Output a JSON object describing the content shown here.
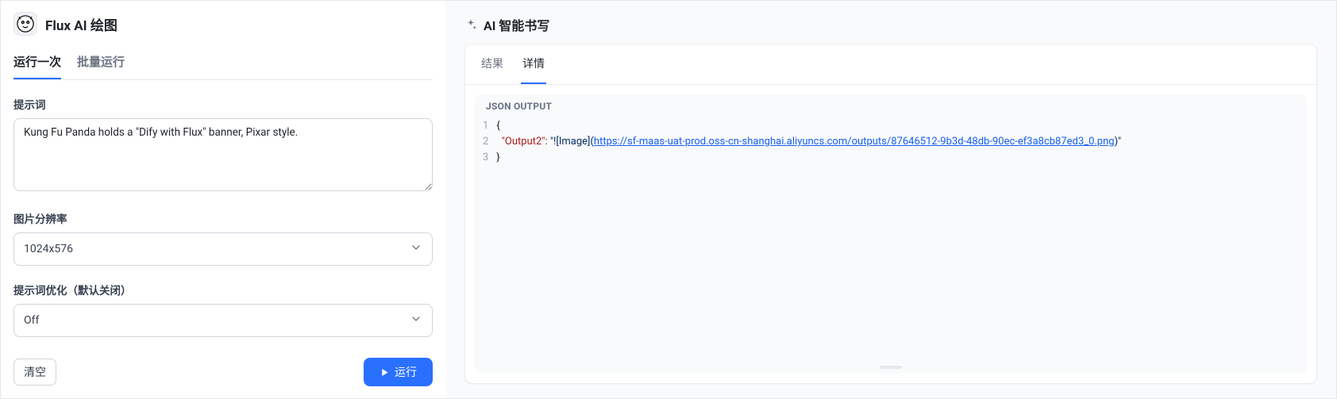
{
  "left": {
    "title": "Flux AI 绘图",
    "tabs": [
      {
        "label": "运行一次",
        "active": true
      },
      {
        "label": "批量运行",
        "active": false
      }
    ],
    "promptLabel": "提示词",
    "promptValue": "Kung Fu Panda holds a \"Dify with Flux\" banner, Pixar style.",
    "resolutionLabel": "图片分辨率",
    "resolutionValue": "1024x576",
    "optimizeLabel": "提示词优化（默认关闭）",
    "optimizeValue": "Off",
    "clearLabel": "清空",
    "runLabel": "运行"
  },
  "right": {
    "title": "AI 智能书写",
    "tabs": [
      {
        "label": "结果",
        "active": false
      },
      {
        "label": "详情",
        "active": true
      }
    ],
    "jsonHeading": "JSON OUTPUT",
    "json": {
      "lineNumbers": [
        "1",
        "2",
        "3"
      ],
      "key": "\"Output2\"",
      "valuePrefix": "\"![Image](",
      "url": "https://sf-maas-uat-prod.oss-cn-shanghai.aliyuncs.com/outputs/87646512-9b3d-48db-90ec-ef3a8cb87ed3_0.png",
      "valueSuffix": ")\""
    }
  }
}
